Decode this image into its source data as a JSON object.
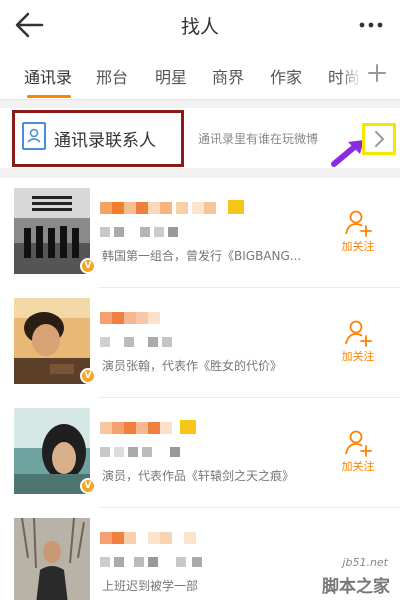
{
  "header": {
    "title": "找人",
    "back_icon": "back-arrow-icon",
    "more_icon": "more-dots-icon"
  },
  "tabs": [
    {
      "label": "通讯录",
      "active": true
    },
    {
      "label": "邢台"
    },
    {
      "label": "明星"
    },
    {
      "label": "商界"
    },
    {
      "label": "作家"
    },
    {
      "label": "时尚"
    }
  ],
  "add_tab_icon": "plus-icon",
  "contacts": {
    "label": "通讯录联系人",
    "hint": "通讯录里有谁在玩微博",
    "icon": "contacts-book-icon",
    "arrow_icon": "chevron-right-icon"
  },
  "users": [
    {
      "desc": "韩国第一组合，曾发行《BIGBANG...",
      "follow_label": "加关注"
    },
    {
      "desc": "演员张翰，代表作《胜女的代价》",
      "follow_label": "加关注"
    },
    {
      "desc": "演员，代表作品《轩辕剑之天之痕》",
      "follow_label": "加关注"
    },
    {
      "desc": "上班迟到被学一部",
      "follow_label": ""
    }
  ],
  "colors": {
    "accent": "#ff8200",
    "verified": "#f5a623",
    "annotation_box": "#8b1a1a",
    "annotation_yellow": "#f5e600",
    "annotation_arrow": "#8a2be2"
  },
  "watermark": {
    "site": "jb51.net",
    "name": "脚本之家"
  }
}
